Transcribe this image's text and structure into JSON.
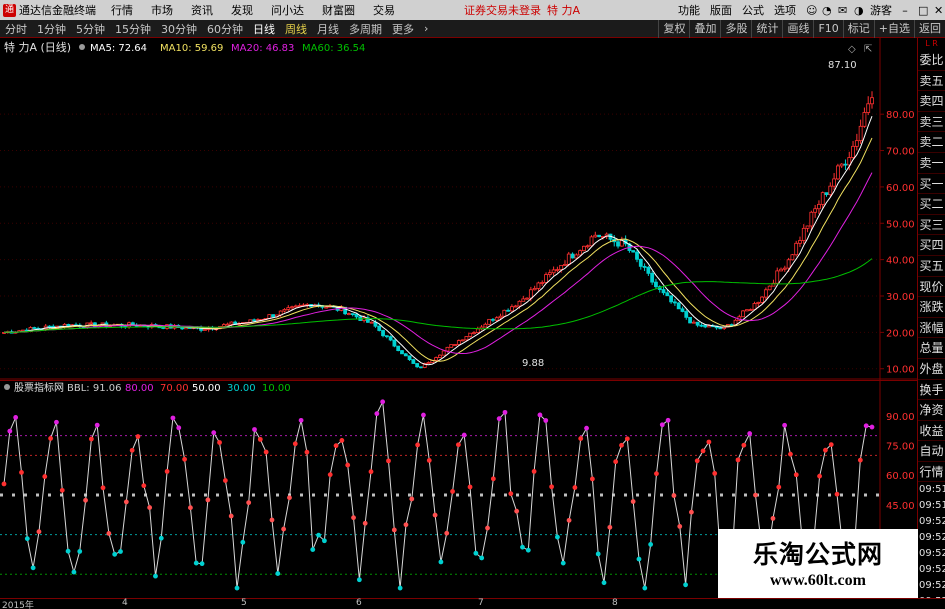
{
  "menubar": {
    "app_title": "通达信金融终端",
    "items": [
      "行情",
      "市场",
      "资讯",
      "发现",
      "问小达",
      "财富圈",
      "交易"
    ],
    "status": "证券交易未登录",
    "stock": "特 力A",
    "right_items": [
      "功能",
      "版面",
      "公式",
      "选项"
    ],
    "guest": "游客"
  },
  "toolbar": {
    "timeframes": [
      "分时",
      "1分钟",
      "5分钟",
      "15分钟",
      "30分钟",
      "60分钟",
      "日线",
      "周线",
      "月线",
      "多周期",
      "更多"
    ],
    "active": "日线",
    "right_tools": [
      "复权",
      "叠加",
      "多股",
      "统计",
      "画线",
      "F10",
      "标记",
      "+自选",
      "返回"
    ]
  },
  "main_chart": {
    "title": "特 力A (日线)",
    "ma5": "MA5: 72.64",
    "ma10": "MA10: 59.69",
    "ma20": "MA20: 46.83",
    "ma60": "MA60: 36.54",
    "high_label": "87.10",
    "low_label": "9.88",
    "y_ticks": [
      "80.00",
      "70.00",
      "60.00",
      "50.00",
      "40.00",
      "30.00",
      "20.00",
      "10.00"
    ],
    "y_range": [
      8,
      96
    ]
  },
  "indicator": {
    "name": "股票指标网",
    "bbl": "BBL: 91.06",
    "l80": "80.00",
    "l70": "70.00",
    "l50": "50.00",
    "l30": "30.00",
    "l10": "10.00",
    "y_ticks": [
      "90.00",
      "75.00",
      "60.00",
      "45.00"
    ]
  },
  "right_panel": {
    "top": "L R",
    "items": [
      "委比",
      "卖五",
      "卖四",
      "卖三",
      "卖二",
      "卖一",
      "买一",
      "买二",
      "买三",
      "买四",
      "买五",
      "现价",
      "涨跌",
      "涨幅",
      "总量",
      "外盘",
      "换手",
      "净资",
      "收益",
      "自动",
      "行情"
    ],
    "times": [
      "09:51",
      "09:51",
      "09:52",
      "09:52",
      "09:52",
      "09:52",
      "09:52",
      "09:52",
      "09:52"
    ]
  },
  "bottom_bar": {
    "dates": [
      "2015年",
      "4",
      "5",
      "6",
      "7",
      "8"
    ]
  },
  "watermark": {
    "title": "乐淘公式网",
    "url": "www.60lt.com"
  },
  "colors": {
    "up": "#ff3030",
    "down": "#00d0d0",
    "ma5": "#ffffff",
    "ma10": "#f0e060",
    "ma20": "#e020e0",
    "ma60": "#00c000",
    "axis": "#7a0000"
  }
}
